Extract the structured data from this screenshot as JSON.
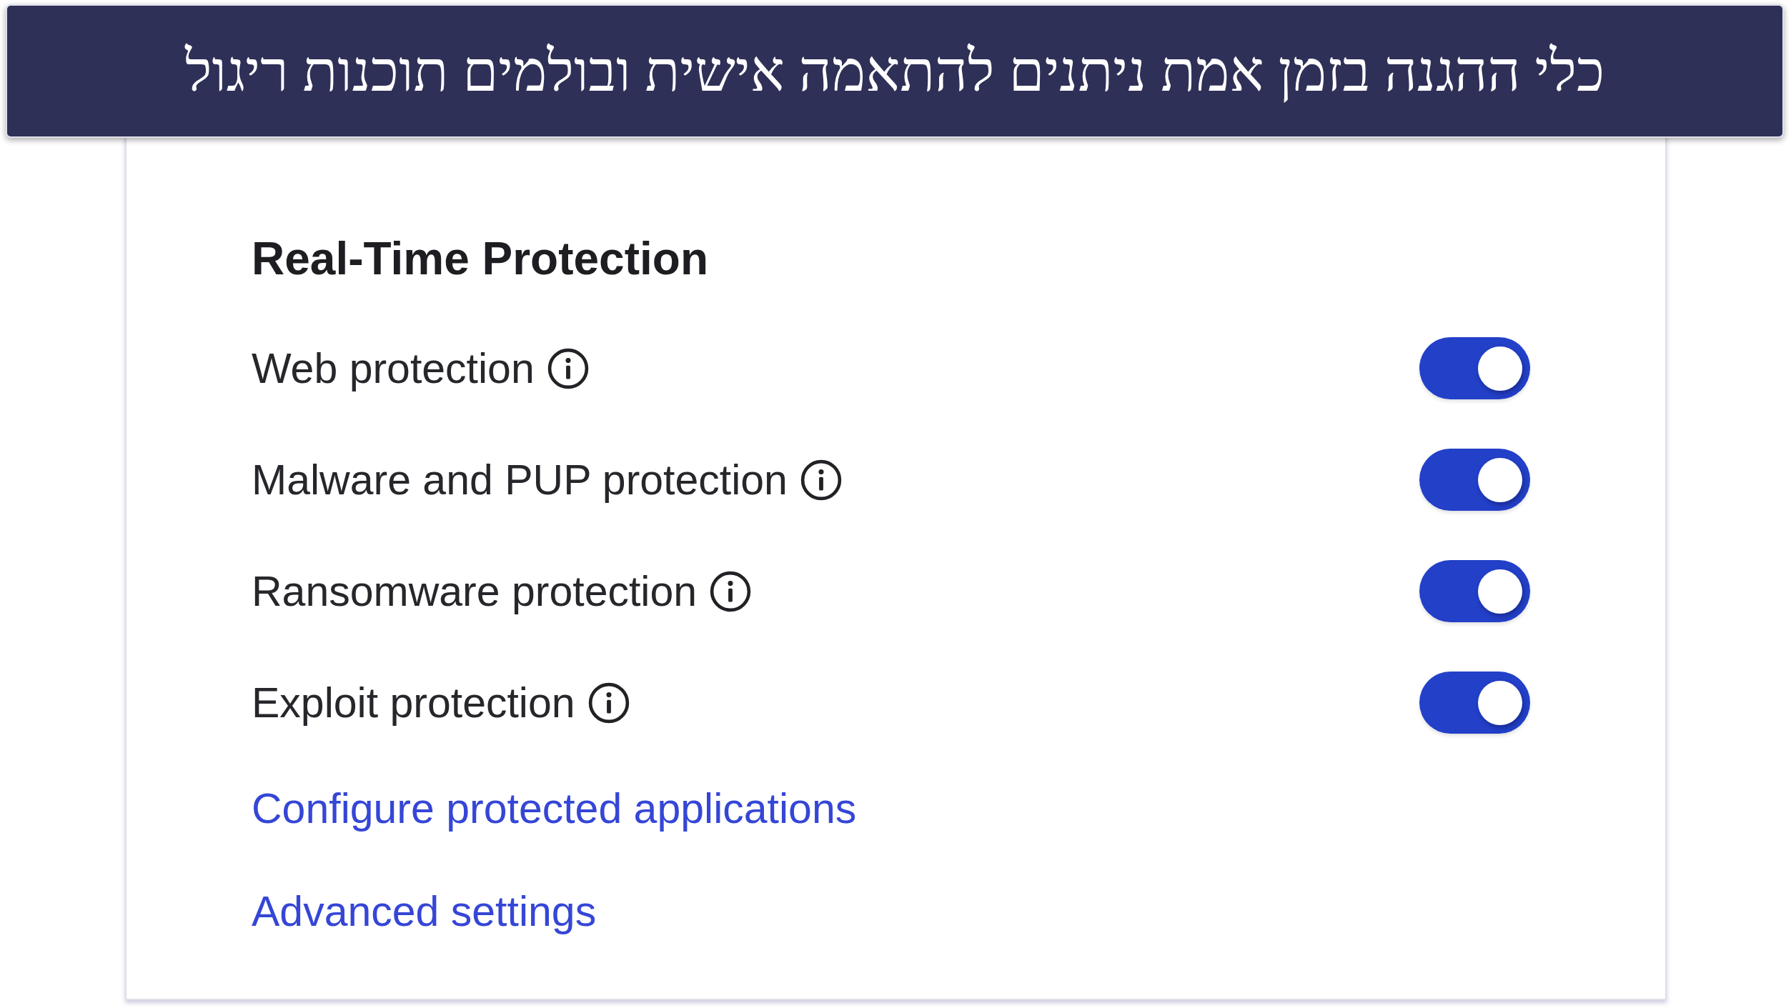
{
  "banner": {
    "title": "כלי ההגנה בזמן אמת ניתנים להתאמה אישית ובולמים תוכנות ריגול"
  },
  "panel": {
    "heading": "Real-Time Protection",
    "settings": [
      {
        "label": "Web protection",
        "on": true
      },
      {
        "label": "Malware and PUP protection",
        "on": true
      },
      {
        "label": "Ransomware protection",
        "on": true
      },
      {
        "label": "Exploit protection",
        "on": true
      }
    ],
    "links": [
      "Configure protected applications",
      "Advanced settings"
    ]
  }
}
